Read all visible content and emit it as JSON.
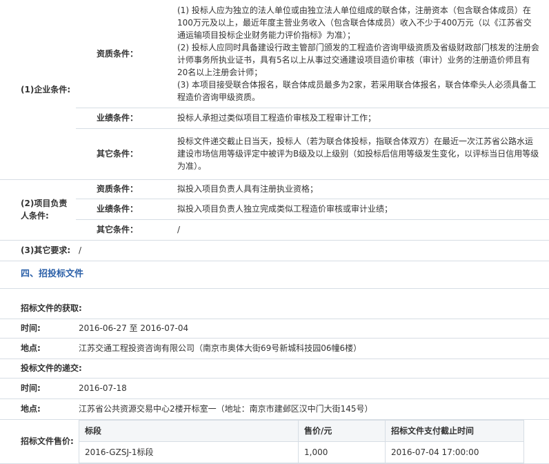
{
  "enterprise": {
    "label": "(1)企业条件:",
    "qualification_label": "资质条件：",
    "qualification_text": "(1) 投标人应为独立的法人单位或由独立法人单位组成的联合体，注册资本（包含联合体成员）在100万元及以上，最近年度主营业务收入（包含联合体成员）收入不少于400万元（以《江苏省交通运输项目投标企业财务能力评价指标》为准）；\n(2) 投标人应同时具备建设行政主管部门颁发的工程造价咨询甲级资质及省级财政部门核发的注册会计师事务所执业证书，具有5名以上从事过交通建设项目造价审核（审计）业务的注册造价师且有20名以上注册会计师；\n(3) 本项目接受联合体报名，联合体成员最多为2家，若采用联合体报名，联合体牵头人必须具备工程造价咨询甲级资质。",
    "performance_label": "业绩条件：",
    "performance_text": "投标人承担过类似项目工程造价审核及工程审计工作；",
    "other_label": "其它条件：",
    "other_text": "投标文件递交截止日当天，投标人（若为联合体投标，指联合体双方）在最近一次江苏省公路水运建设市场信用等级评定中被评为B级及以上级别（如投标后信用等级发生变化，以评标当日信用等级为准）。"
  },
  "project_lead": {
    "label": "(2)项目负责人条件:",
    "qualification_label": "资质条件：",
    "qualification_text": "拟投入项目负责人具有注册执业资格；",
    "performance_label": "业绩条件：",
    "performance_text": "拟投入项目负责人独立完成类似工程造价审核或审计业绩；",
    "other_label": "其它条件：",
    "other_text": "/"
  },
  "other_requirements": {
    "label": "(3)其它要求:",
    "text": "/"
  },
  "section4": {
    "title": "四、招投标文件"
  },
  "tender_docs": {
    "obtain_label": "招标文件的获取:",
    "time_label": "时间:",
    "time_value": "2016-06-27 至 2016-07-04",
    "place_label": "地点:",
    "place_value": "江苏交通工程投资咨询有限公司（南京市奥体大街69号新城科技园06幢6楼）",
    "submit_label": "投标文件的递交:",
    "submit_time_label": "时间:",
    "submit_time_value": "2016-07-18",
    "submit_place_label": "地点:",
    "submit_place_value": "江苏省公共资源交易中心2楼开标室一（地址：南京市建邺区汉中门大街145号）",
    "price_label": "招标文件售价:",
    "price_table": {
      "headers": [
        "标段",
        "售价/元",
        "招标文件支付截止时间"
      ],
      "rows": [
        [
          "2016-GZSJ-1标段",
          "1,000",
          "2016-07-04 17:00:00"
        ]
      ]
    }
  }
}
